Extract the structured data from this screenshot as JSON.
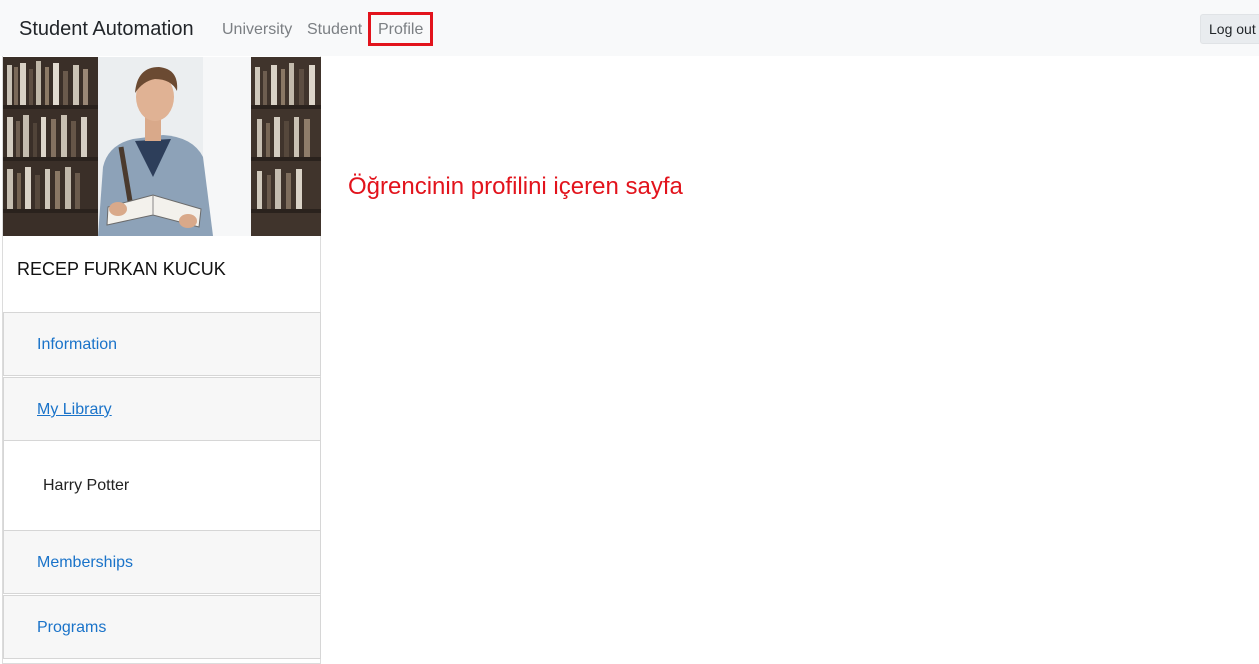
{
  "navbar": {
    "brand": "Student Automation",
    "links": [
      "University",
      "Student",
      "Profile"
    ],
    "logout_label": "Log out",
    "highlight_color": "#e2131c"
  },
  "profile": {
    "photo_icon": "student-reading-book-photo",
    "name": "RECEP FURKAN KUCUK"
  },
  "sidebar": {
    "items": [
      {
        "label": "Information"
      },
      {
        "label": "My Library",
        "expanded": true,
        "content": [
          "Harry Potter"
        ]
      },
      {
        "label": "Memberships"
      },
      {
        "label": "Programs"
      }
    ]
  },
  "main": {
    "caption": "Öğrencinin profilini içeren sayfa"
  }
}
